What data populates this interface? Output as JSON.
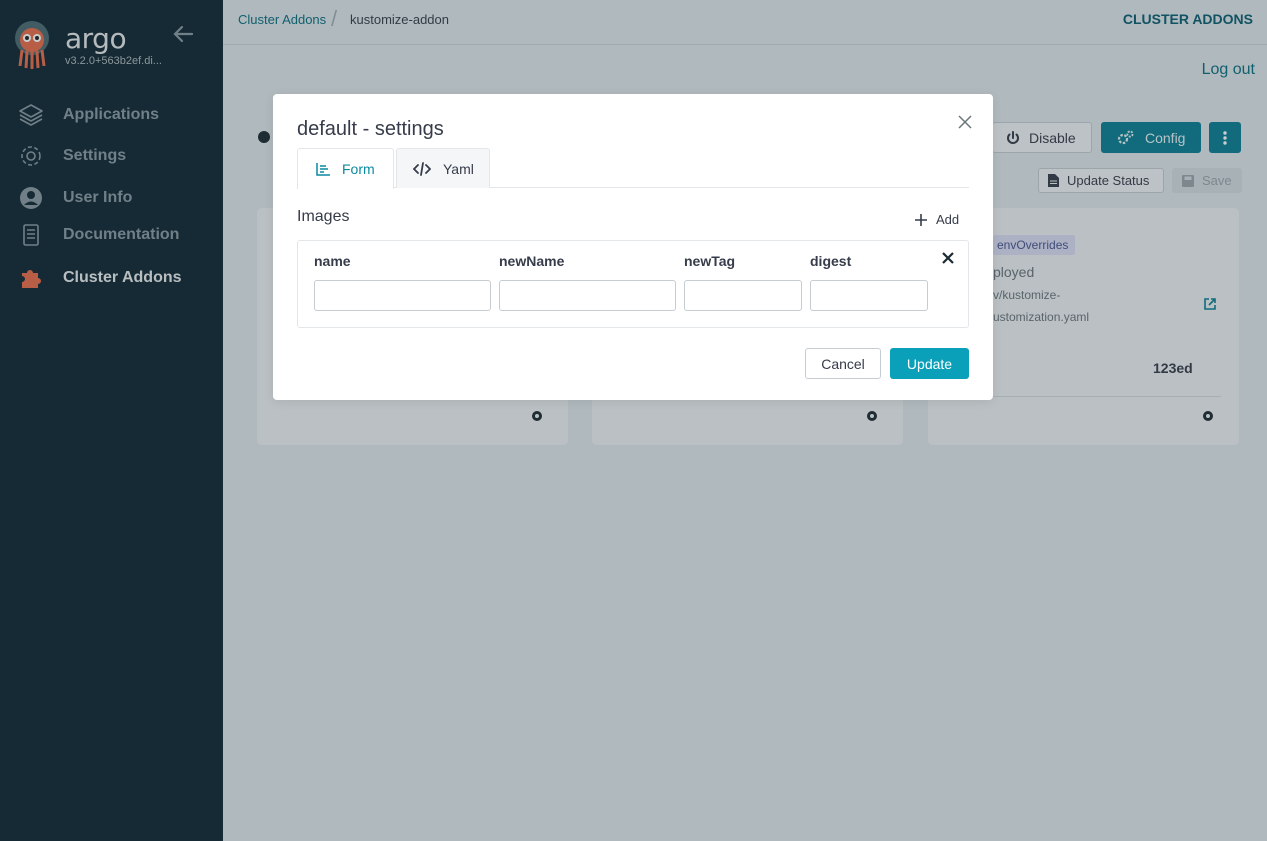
{
  "sidebar": {
    "brand": "argo",
    "version": "v3.2.0+563b2ef.di...",
    "items": [
      {
        "label": "Applications",
        "icon": "layers-icon"
      },
      {
        "label": "Settings",
        "icon": "gear-icon"
      },
      {
        "label": "User Info",
        "icon": "user-icon"
      },
      {
        "label": "Documentation",
        "icon": "document-icon"
      },
      {
        "label": "Cluster Addons",
        "icon": "puzzle-icon",
        "active": true
      }
    ]
  },
  "breadcrumb": {
    "parent": "Cluster Addons",
    "separator": "/",
    "current": "kustomize-addon"
  },
  "header": {
    "page_title": "CLUSTER ADDONS",
    "logout": "Log out"
  },
  "toolbar": {
    "disable_label": "Disable",
    "config_label": "Config",
    "update_status_label": "Update Status",
    "save_label": "Save"
  },
  "background_card": {
    "tag": "envOverrides",
    "status": "ployed",
    "path_line1": "v/kustomize-",
    "path_line2": "ustomization.yaml",
    "hash": "123ed"
  },
  "modal": {
    "title": "default - settings",
    "tabs": [
      {
        "label": "Form",
        "icon": "form-icon"
      },
      {
        "label": "Yaml",
        "icon": "code-icon"
      }
    ],
    "section_title": "Images",
    "add_label": "Add",
    "fields": [
      {
        "label": "name",
        "value": ""
      },
      {
        "label": "newName",
        "value": ""
      },
      {
        "label": "newTag",
        "value": ""
      },
      {
        "label": "digest",
        "value": ""
      }
    ],
    "cancel_label": "Cancel",
    "update_label": "Update"
  },
  "colors": {
    "sidebar_bg": "#0f2733",
    "accent": "#0a7e93",
    "primary_button": "#0aa0ba",
    "addons_icon": "#e96d4c"
  }
}
